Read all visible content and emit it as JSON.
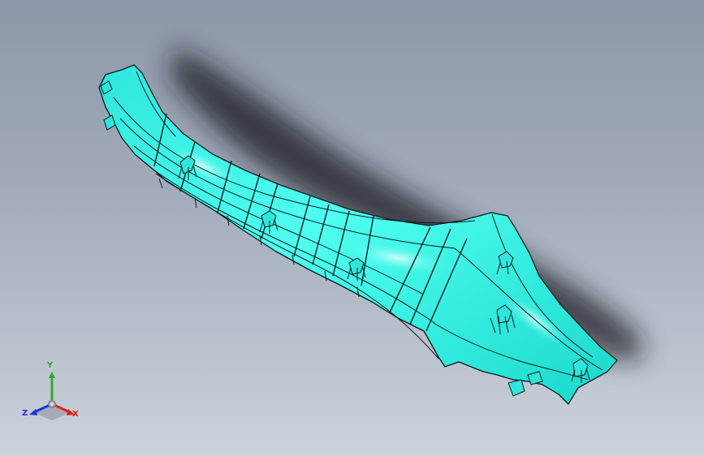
{
  "viewport": {
    "background_top": "#8c97a8",
    "background_bottom": "#cdd3dc"
  },
  "model": {
    "part_color": "#33f0e0",
    "edge_color": "#0a1a1a"
  },
  "triad": {
    "x_label": "X",
    "y_label": "Y",
    "z_label": "Z",
    "x_color": "#e0201a",
    "y_color": "#28b028",
    "z_color": "#2030e0"
  }
}
